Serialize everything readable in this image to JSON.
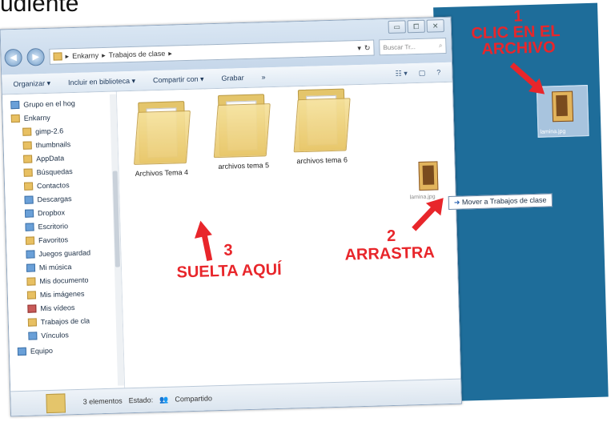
{
  "caption_fragment": "udiente",
  "window": {
    "controls": [
      "▭",
      "⧠",
      "✕"
    ],
    "breadcrumb": [
      "Enkarny",
      "Trabajos de clase"
    ],
    "search_placeholder": "Buscar Tr...",
    "toolbar": {
      "organize": "Organizar ▾",
      "include": "Incluir en biblioteca ▾",
      "share": "Compartir con ▾",
      "burn": "Grabar",
      "more": "»"
    },
    "nav_items": [
      {
        "label": "Grupo en el hog",
        "icon": "homegroup-icon"
      },
      {
        "label": "Enkarny",
        "icon": "user-folder-icon"
      },
      {
        "label": "gimp-2.6",
        "icon": "folder-icon"
      },
      {
        "label": "thumbnails",
        "icon": "folder-icon"
      },
      {
        "label": "AppData",
        "icon": "folder-icon"
      },
      {
        "label": "Búsquedas",
        "icon": "folder-icon"
      },
      {
        "label": "Contactos",
        "icon": "folder-icon"
      },
      {
        "label": "Descargas",
        "icon": "downloads-icon"
      },
      {
        "label": "Dropbox",
        "icon": "dropbox-icon"
      },
      {
        "label": "Escritorio",
        "icon": "desktop-folder-icon"
      },
      {
        "label": "Favoritos",
        "icon": "folder-icon"
      },
      {
        "label": "Juegos guardad",
        "icon": "games-icon"
      },
      {
        "label": "Mi música",
        "icon": "music-icon"
      },
      {
        "label": "Mis documento",
        "icon": "documents-icon"
      },
      {
        "label": "Mis imágenes",
        "icon": "pictures-icon"
      },
      {
        "label": "Mis vídeos",
        "icon": "videos-icon"
      },
      {
        "label": "Trabajos de cla",
        "icon": "folder-icon"
      },
      {
        "label": "Vínculos",
        "icon": "links-icon"
      },
      {
        "label": "Equipo",
        "icon": "computer-icon"
      }
    ],
    "folders": [
      {
        "label": "Archivos Tema 4"
      },
      {
        "label": "archivos tema 5"
      },
      {
        "label": "archivos tema 6"
      }
    ],
    "status": {
      "count": "3 elementos",
      "state_label": "Estado:",
      "state_value": "Compartido"
    }
  },
  "drag": {
    "file_label": "lamina.jpg",
    "tooltip": "Mover a Trabajos de clase"
  },
  "desktop_file": {
    "label": "lamina.jpg"
  },
  "annotations": {
    "step1_num": "1",
    "step1_text_line1": "CLIC EN EL",
    "step1_text_line2": "ARCHIVO",
    "step2_num": "2",
    "step2_text": "ARRASTRA",
    "step3_num": "3",
    "step3_text": "SUELTA AQUÍ"
  },
  "colors": {
    "annotation": "#e8262b",
    "desktop": "#1e6d9a"
  }
}
